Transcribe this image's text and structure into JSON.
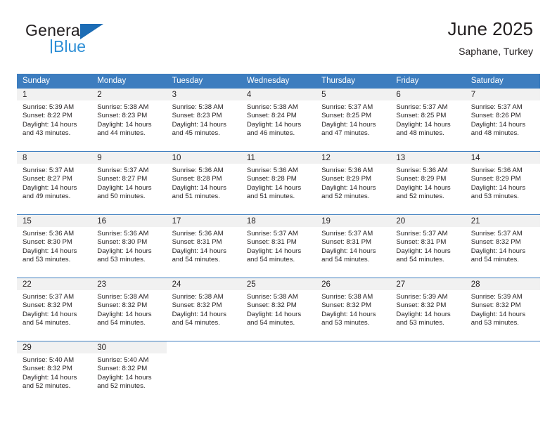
{
  "brand": {
    "name_top": "General",
    "name_bottom": "Blue",
    "triangle_color": "#1c6cb5",
    "bottom_color": "#2e8fd6"
  },
  "header": {
    "title": "June 2025",
    "subtitle": "Saphane, Turkey"
  },
  "theme": {
    "header_bg": "#3d7dbf",
    "header_text": "#ffffff",
    "daynum_bg": "#f1f1f1",
    "body_text": "#231f20"
  },
  "labels": {
    "sunrise_prefix": "Sunrise:",
    "sunset_prefix": "Sunset:",
    "daylight_prefix": "Daylight:"
  },
  "columns": [
    "Sunday",
    "Monday",
    "Tuesday",
    "Wednesday",
    "Thursday",
    "Friday",
    "Saturday"
  ],
  "weeks": [
    [
      {
        "day": "1",
        "sunrise": "Sunrise: 5:39 AM",
        "sunset": "Sunset: 8:22 PM",
        "daylight1": "Daylight: 14 hours",
        "daylight2": "and 43 minutes."
      },
      {
        "day": "2",
        "sunrise": "Sunrise: 5:38 AM",
        "sunset": "Sunset: 8:23 PM",
        "daylight1": "Daylight: 14 hours",
        "daylight2": "and 44 minutes."
      },
      {
        "day": "3",
        "sunrise": "Sunrise: 5:38 AM",
        "sunset": "Sunset: 8:23 PM",
        "daylight1": "Daylight: 14 hours",
        "daylight2": "and 45 minutes."
      },
      {
        "day": "4",
        "sunrise": "Sunrise: 5:38 AM",
        "sunset": "Sunset: 8:24 PM",
        "daylight1": "Daylight: 14 hours",
        "daylight2": "and 46 minutes."
      },
      {
        "day": "5",
        "sunrise": "Sunrise: 5:37 AM",
        "sunset": "Sunset: 8:25 PM",
        "daylight1": "Daylight: 14 hours",
        "daylight2": "and 47 minutes."
      },
      {
        "day": "6",
        "sunrise": "Sunrise: 5:37 AM",
        "sunset": "Sunset: 8:25 PM",
        "daylight1": "Daylight: 14 hours",
        "daylight2": "and 48 minutes."
      },
      {
        "day": "7",
        "sunrise": "Sunrise: 5:37 AM",
        "sunset": "Sunset: 8:26 PM",
        "daylight1": "Daylight: 14 hours",
        "daylight2": "and 48 minutes."
      }
    ],
    [
      {
        "day": "8",
        "sunrise": "Sunrise: 5:37 AM",
        "sunset": "Sunset: 8:27 PM",
        "daylight1": "Daylight: 14 hours",
        "daylight2": "and 49 minutes."
      },
      {
        "day": "9",
        "sunrise": "Sunrise: 5:37 AM",
        "sunset": "Sunset: 8:27 PM",
        "daylight1": "Daylight: 14 hours",
        "daylight2": "and 50 minutes."
      },
      {
        "day": "10",
        "sunrise": "Sunrise: 5:36 AM",
        "sunset": "Sunset: 8:28 PM",
        "daylight1": "Daylight: 14 hours",
        "daylight2": "and 51 minutes."
      },
      {
        "day": "11",
        "sunrise": "Sunrise: 5:36 AM",
        "sunset": "Sunset: 8:28 PM",
        "daylight1": "Daylight: 14 hours",
        "daylight2": "and 51 minutes."
      },
      {
        "day": "12",
        "sunrise": "Sunrise: 5:36 AM",
        "sunset": "Sunset: 8:29 PM",
        "daylight1": "Daylight: 14 hours",
        "daylight2": "and 52 minutes."
      },
      {
        "day": "13",
        "sunrise": "Sunrise: 5:36 AM",
        "sunset": "Sunset: 8:29 PM",
        "daylight1": "Daylight: 14 hours",
        "daylight2": "and 52 minutes."
      },
      {
        "day": "14",
        "sunrise": "Sunrise: 5:36 AM",
        "sunset": "Sunset: 8:29 PM",
        "daylight1": "Daylight: 14 hours",
        "daylight2": "and 53 minutes."
      }
    ],
    [
      {
        "day": "15",
        "sunrise": "Sunrise: 5:36 AM",
        "sunset": "Sunset: 8:30 PM",
        "daylight1": "Daylight: 14 hours",
        "daylight2": "and 53 minutes."
      },
      {
        "day": "16",
        "sunrise": "Sunrise: 5:36 AM",
        "sunset": "Sunset: 8:30 PM",
        "daylight1": "Daylight: 14 hours",
        "daylight2": "and 53 minutes."
      },
      {
        "day": "17",
        "sunrise": "Sunrise: 5:36 AM",
        "sunset": "Sunset: 8:31 PM",
        "daylight1": "Daylight: 14 hours",
        "daylight2": "and 54 minutes."
      },
      {
        "day": "18",
        "sunrise": "Sunrise: 5:37 AM",
        "sunset": "Sunset: 8:31 PM",
        "daylight1": "Daylight: 14 hours",
        "daylight2": "and 54 minutes."
      },
      {
        "day": "19",
        "sunrise": "Sunrise: 5:37 AM",
        "sunset": "Sunset: 8:31 PM",
        "daylight1": "Daylight: 14 hours",
        "daylight2": "and 54 minutes."
      },
      {
        "day": "20",
        "sunrise": "Sunrise: 5:37 AM",
        "sunset": "Sunset: 8:31 PM",
        "daylight1": "Daylight: 14 hours",
        "daylight2": "and 54 minutes."
      },
      {
        "day": "21",
        "sunrise": "Sunrise: 5:37 AM",
        "sunset": "Sunset: 8:32 PM",
        "daylight1": "Daylight: 14 hours",
        "daylight2": "and 54 minutes."
      }
    ],
    [
      {
        "day": "22",
        "sunrise": "Sunrise: 5:37 AM",
        "sunset": "Sunset: 8:32 PM",
        "daylight1": "Daylight: 14 hours",
        "daylight2": "and 54 minutes."
      },
      {
        "day": "23",
        "sunrise": "Sunrise: 5:38 AM",
        "sunset": "Sunset: 8:32 PM",
        "daylight1": "Daylight: 14 hours",
        "daylight2": "and 54 minutes."
      },
      {
        "day": "24",
        "sunrise": "Sunrise: 5:38 AM",
        "sunset": "Sunset: 8:32 PM",
        "daylight1": "Daylight: 14 hours",
        "daylight2": "and 54 minutes."
      },
      {
        "day": "25",
        "sunrise": "Sunrise: 5:38 AM",
        "sunset": "Sunset: 8:32 PM",
        "daylight1": "Daylight: 14 hours",
        "daylight2": "and 54 minutes."
      },
      {
        "day": "26",
        "sunrise": "Sunrise: 5:38 AM",
        "sunset": "Sunset: 8:32 PM",
        "daylight1": "Daylight: 14 hours",
        "daylight2": "and 53 minutes."
      },
      {
        "day": "27",
        "sunrise": "Sunrise: 5:39 AM",
        "sunset": "Sunset: 8:32 PM",
        "daylight1": "Daylight: 14 hours",
        "daylight2": "and 53 minutes."
      },
      {
        "day": "28",
        "sunrise": "Sunrise: 5:39 AM",
        "sunset": "Sunset: 8:32 PM",
        "daylight1": "Daylight: 14 hours",
        "daylight2": "and 53 minutes."
      }
    ],
    [
      {
        "day": "29",
        "sunrise": "Sunrise: 5:40 AM",
        "sunset": "Sunset: 8:32 PM",
        "daylight1": "Daylight: 14 hours",
        "daylight2": "and 52 minutes."
      },
      {
        "day": "30",
        "sunrise": "Sunrise: 5:40 AM",
        "sunset": "Sunset: 8:32 PM",
        "daylight1": "Daylight: 14 hours",
        "daylight2": "and 52 minutes."
      },
      {
        "day": "",
        "sunrise": "",
        "sunset": "",
        "daylight1": "",
        "daylight2": ""
      },
      {
        "day": "",
        "sunrise": "",
        "sunset": "",
        "daylight1": "",
        "daylight2": ""
      },
      {
        "day": "",
        "sunrise": "",
        "sunset": "",
        "daylight1": "",
        "daylight2": ""
      },
      {
        "day": "",
        "sunrise": "",
        "sunset": "",
        "daylight1": "",
        "daylight2": ""
      },
      {
        "day": "",
        "sunrise": "",
        "sunset": "",
        "daylight1": "",
        "daylight2": ""
      }
    ]
  ]
}
